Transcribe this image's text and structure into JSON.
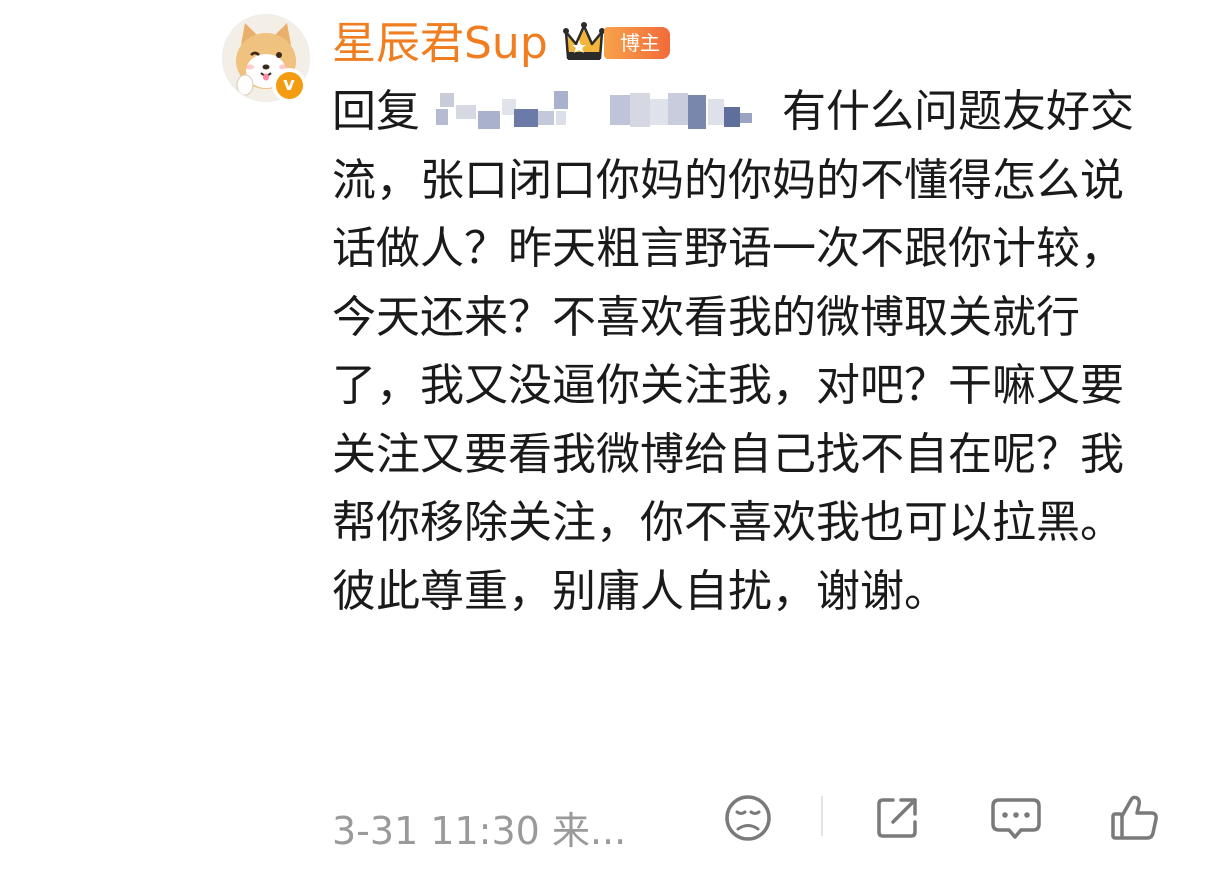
{
  "comment": {
    "author": {
      "name": "星辰君Sup",
      "role_badge": "博主",
      "avatar": "shiba-dog-avatar",
      "verified_icon": "v"
    },
    "reply_prefix": "回复",
    "text": "有什么问题友好交流，张口闭口你妈的你妈的不懂得怎么说话做人？昨天粗言野语一次不跟你计较，今天还来？不喜欢看我的微博取关就行了，我又没逼你关注我，对吧？干嘛又要关注又要看我微博给自己找不自在呢？我帮你移除关注，你不喜欢我也可以拉黑。彼此尊重，别庸人自扰，谢谢。",
    "time": "3-31 11:30",
    "source": "来..."
  },
  "actions": [
    {
      "name": "dislike",
      "icon": "sad-face-icon"
    },
    {
      "name": "share",
      "icon": "share-icon"
    },
    {
      "name": "reply",
      "icon": "comment-bubble-icon"
    },
    {
      "name": "like",
      "icon": "thumbs-up-icon"
    }
  ],
  "colors": {
    "username": "#f07e21",
    "badge": "#f26b3a",
    "verified": "#f39c12",
    "meta": "#9a9a9a",
    "icon": "#7a7a7a"
  }
}
